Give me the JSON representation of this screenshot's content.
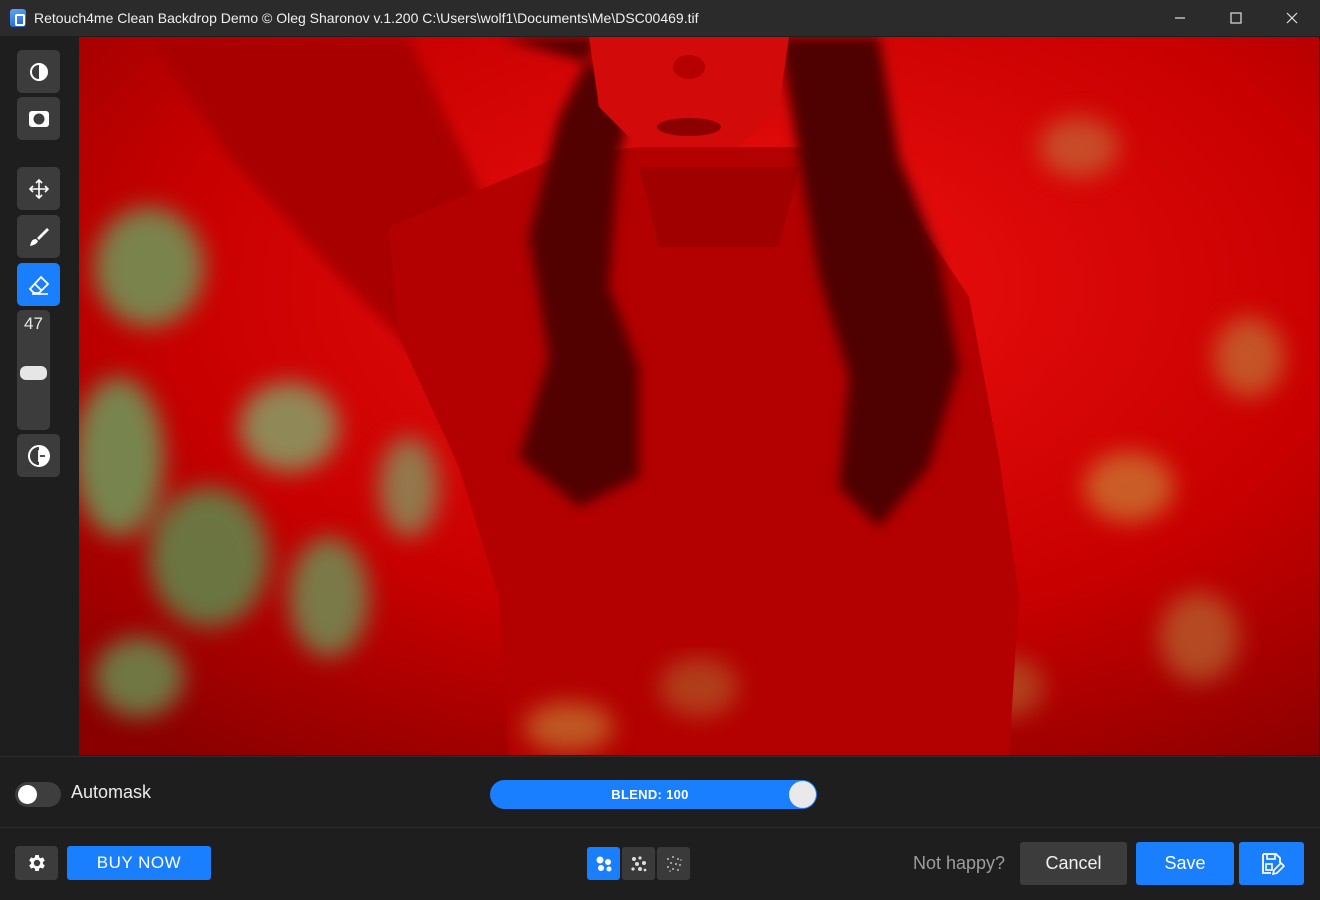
{
  "window": {
    "title": "Retouch4me Clean Backdrop Demo © Oleg Sharonov v.1.200 C:\\Users\\wolf1\\Documents\\Me\\DSC00469.tif",
    "controls": [
      "minimize-icon",
      "maximize-icon",
      "close-icon"
    ]
  },
  "toolbar": {
    "tools": [
      {
        "icon": "contrast-icon",
        "active": false
      },
      {
        "icon": "mask-icon",
        "active": false
      },
      {
        "icon": "move-icon",
        "active": false
      },
      {
        "icon": "brush-icon",
        "active": false
      },
      {
        "icon": "eraser-icon",
        "active": true
      },
      {
        "icon": "compare-icon",
        "active": false
      }
    ],
    "brush_size": "47"
  },
  "controls": {
    "automask_label": "Automask",
    "automask_enabled": false,
    "blend_label": "BLEND: 100",
    "blend_value": 100
  },
  "bottom": {
    "settings_icon": "gear-icon",
    "buy_label": "BUY NOW",
    "view_modes": [
      "dots-large-icon",
      "dots-medium-icon",
      "dots-small-icon"
    ],
    "active_view_mode": 0,
    "not_happy_label": "Not happy?",
    "cancel_label": "Cancel",
    "save_label": "Save",
    "save_as_icon": "save-edit-icon"
  },
  "colors": {
    "accent": "#1a7fff",
    "overlay": "#d40000",
    "background": "#1e1e1e",
    "titlebar": "#2b2b2b",
    "button": "#3c3c3c"
  }
}
